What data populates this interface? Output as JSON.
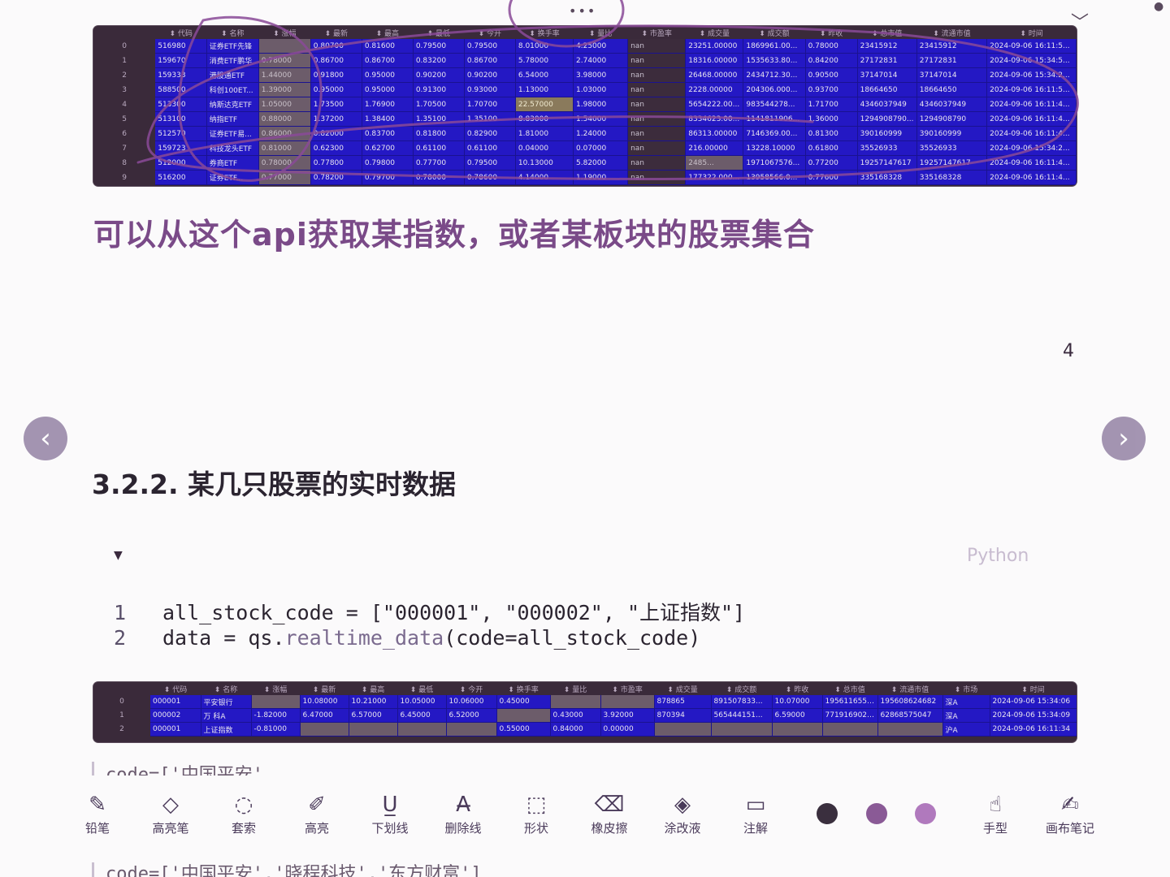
{
  "top_controls": {
    "more": "•••",
    "collapse": "﹀",
    "corner": "●"
  },
  "table1": {
    "headers": [
      "",
      "代码",
      "名称",
      "涨幅",
      "最新",
      "最高",
      "最低",
      "今开",
      "换手率",
      "量比",
      "市盈率",
      "成交量",
      "成交额",
      "昨收",
      "总市值",
      "流通市值",
      "时间"
    ],
    "rows": [
      [
        "0",
        "516980",
        "证券ETF先锋",
        "",
        "0.80700",
        "0.81600",
        "0.79500",
        "0.79500",
        "8.01000",
        "4.25000",
        "nan",
        "23251.00000",
        "1869961.00...",
        "0.78000",
        "23415912",
        "23415912",
        "2024-09-06 16:11:5..."
      ],
      [
        "1",
        "159670",
        "消费ETF鹏华",
        "0.78000",
        "0.86700",
        "0.86700",
        "0.83200",
        "0.86700",
        "5.78000",
        "2.74000",
        "nan",
        "18316.00000",
        "1535633.80...",
        "0.84200",
        "27172831",
        "27172831",
        "2024-09-06 15:34:5..."
      ],
      [
        "2",
        "159333",
        "港股通ETF",
        "1.44000",
        "0.91800",
        "0.95000",
        "0.90200",
        "0.90200",
        "6.54000",
        "3.98000",
        "nan",
        "26468.00000",
        "2434712.30...",
        "0.90500",
        "37147014",
        "37147014",
        "2024-09-06 15:34:2..."
      ],
      [
        "3",
        "588500",
        "科创100ET...",
        "1.39000",
        "0.95000",
        "0.95000",
        "0.91300",
        "0.93000",
        "1.13000",
        "1.03000",
        "nan",
        "2228.00000",
        "204306.000...",
        "0.93700",
        "18664650",
        "18664650",
        "2024-09-06 16:11:5..."
      ],
      [
        "4",
        "513300",
        "纳斯达克ETF",
        "1.05000",
        "1.73500",
        "1.76900",
        "1.70500",
        "1.70700",
        "22.57000",
        "1.98000",
        "nan",
        "5654222.00...",
        "983544278...",
        "1.71700",
        "4346037949",
        "4346037949",
        "2024-09-06 16:11:4..."
      ],
      [
        "5",
        "513100",
        "纳指ETF",
        "0.88000",
        "1.37200",
        "1.38400",
        "1.35100",
        "1.35100",
        "8.83000",
        "1.54000",
        "nan",
        "8334623.00...",
        "1141811906...",
        "1.36000",
        "1294908790...",
        "1294908790",
        "2024-09-06 16:11:4..."
      ],
      [
        "6",
        "512570",
        "证券ETF易...",
        "0.86000",
        "0.82000",
        "0.83700",
        "0.81800",
        "0.82900",
        "1.81000",
        "1.24000",
        "nan",
        "86313.00000",
        "7146369.00...",
        "0.81300",
        "390160999",
        "390160999",
        "2024-09-06 16:11:4..."
      ],
      [
        "7",
        "159723",
        "科技龙头ETF",
        "0.81000",
        "0.62300",
        "0.62700",
        "0.61100",
        "0.61100",
        "0.04000",
        "0.07000",
        "nan",
        "216.00000",
        "13228.10000",
        "0.61800",
        "35526933",
        "35526933",
        "2024-09-06 15:34:2..."
      ],
      [
        "8",
        "512000",
        "券商ETF",
        "0.78000",
        "0.77800",
        "0.79800",
        "0.77700",
        "0.79500",
        "10.13000",
        "5.82000",
        "nan",
        "2485...",
        "1971067576...",
        "0.77200",
        "19257147617",
        "19257147617",
        "2024-09-06 16:11:4..."
      ],
      [
        "9",
        "516200",
        "证券ETF...",
        "0.77000",
        "0.78200",
        "0.79700",
        "0.78000",
        "0.78600",
        "4.14000",
        "1.19000",
        "nan",
        "177322.000...",
        "13958566.0...",
        "0.77600",
        "335168328",
        "335168328",
        "2024-09-06 16:11:4..."
      ]
    ]
  },
  "note_heading": "可以从这个api获取某指数，或者某板块的股票集合",
  "page_number": "4",
  "section_heading": "3.2.2. 某几只股票的实时数据",
  "code_block": {
    "language": "Python",
    "lines": [
      {
        "num": "1",
        "pre": "all_stock_code = [\"000001\", \"000002\", \"上证指数\"]",
        "fn": "",
        "post": ""
      },
      {
        "num": "2",
        "pre": "data = qs.",
        "fn": "realtime_data",
        "post": "(code=all_stock_code)"
      }
    ]
  },
  "table2": {
    "headers": [
      "",
      "代码",
      "名称",
      "涨幅",
      "最新",
      "最高",
      "最低",
      "今开",
      "换手率",
      "量比",
      "市盈率",
      "成交量",
      "成交额",
      "昨收",
      "总市值",
      "流通市值",
      "市场",
      "时间"
    ],
    "rows": [
      [
        "0",
        "000001",
        "平安银行",
        "",
        "10.08000",
        "10.21000",
        "10.05000",
        "10.06000",
        "0.45000",
        "",
        "",
        "878865",
        "891507833...",
        "10.07000",
        "1956116554...",
        "195608624682",
        "深A",
        "2024-09-06 15:34:06"
      ],
      [
        "1",
        "000002",
        "万 科A",
        "-1.82000",
        "6.47000",
        "6.57000",
        "6.45000",
        "6.52000",
        "",
        "0.43000",
        "3.92000",
        "870394",
        "565444151...",
        "6.59000",
        "7719169027...",
        "62868575047",
        "深A",
        "2024-09-06 15:34:09"
      ],
      [
        "2",
        "000001",
        "上证指数",
        "-0.81000",
        "",
        "",
        "",
        "",
        "0.55000",
        "0.84000",
        "0.00000",
        "",
        "",
        "",
        "",
        "",
        "沪A",
        "2024-09-06 16:11:34"
      ]
    ]
  },
  "quote1": "code=['中国平安'",
  "quote2": "code=['中国平安','晓程科技','东方财富']",
  "toolbar": {
    "tools": [
      {
        "icon": "✎",
        "label": "铅笔"
      },
      {
        "icon": "◇",
        "label": "高亮笔"
      },
      {
        "icon": "◌",
        "label": "套索"
      },
      {
        "icon": "✐",
        "label": "高亮"
      },
      {
        "icon": "U̲",
        "label": "下划线"
      },
      {
        "icon": "A̶",
        "label": "删除线"
      },
      {
        "icon": "⬚",
        "label": "形状"
      },
      {
        "icon": "⌫",
        "label": "橡皮擦"
      },
      {
        "icon": "◈",
        "label": "涂改液"
      },
      {
        "icon": "▭",
        "label": "注解"
      },
      {
        "icon": "☝",
        "label": "手型"
      },
      {
        "icon": "✍",
        "label": "画布笔记"
      }
    ],
    "colors": [
      "#3a2f3e",
      "#8a5a96",
      "#b079bd"
    ]
  }
}
